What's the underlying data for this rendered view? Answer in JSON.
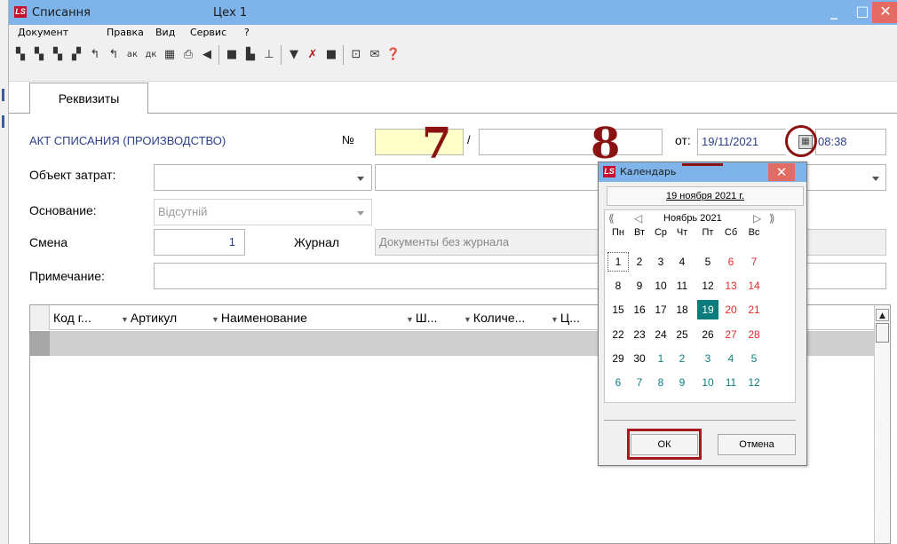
{
  "window": {
    "app_logo": "LS",
    "title": "Списання",
    "subtitle": "Цех 1",
    "min_label": "_",
    "max_label": "□",
    "close_label": "✕"
  },
  "menu": [
    "Документ",
    "Правка",
    "Вид",
    "Сервис",
    "?"
  ],
  "toolbar_icons": [
    "add-icon",
    "add-copy-icon",
    "add-group-icon",
    "edit-icon",
    "refresh-icon",
    "refresh-all-icon",
    "sort-asc-icon",
    "sort-desc-icon",
    "calc-icon",
    "print-icon",
    "previous-icon",
    "save-icon",
    "copy-icon",
    "tree-icon",
    "filter-icon",
    "clear-filter-icon",
    "table-icon",
    "preview-icon",
    "mail-icon",
    "help-icon"
  ],
  "tab": {
    "label": "Реквизиты"
  },
  "form": {
    "doc_type": "АКТ СПИСАНИЯ (ПРОИЗВОДСТВО)",
    "number_label": "№",
    "number_sep": "/",
    "date_label": "от:",
    "date_value": "19/11/2021",
    "time_value": "08:38",
    "cost_object_label": "Объект затрат:",
    "basis_label": "Основание:",
    "basis_value": "Відсутній",
    "shift_label": "Смена",
    "shift_value": "1",
    "journal_label": "Журнал",
    "journal_value": "Документы без журнала",
    "note_label": "Примечание:"
  },
  "grid": {
    "columns": [
      "Код г...",
      "Артикул",
      "Наименование",
      "Ш...",
      "Количе...",
      "Ц..."
    ]
  },
  "annotations": {
    "n7": "7",
    "n8": "8"
  },
  "calendar": {
    "title": "Календарь",
    "today_link": "19 ноября 2021 г.",
    "month_label": "Ноябрь 2021",
    "weekdays": [
      "Пн",
      "Вт",
      "Ср",
      "Чт",
      "Пт",
      "Сб",
      "Вс"
    ],
    "weeks": [
      [
        "1",
        "2",
        "3",
        "4",
        "5",
        "6",
        "7"
      ],
      [
        "8",
        "9",
        "10",
        "11",
        "12",
        "13",
        "14"
      ],
      [
        "15",
        "16",
        "17",
        "18",
        "19",
        "20",
        "21"
      ],
      [
        "22",
        "23",
        "24",
        "25",
        "26",
        "27",
        "28"
      ],
      [
        "29",
        "30",
        "1",
        "2",
        "3",
        "4",
        "5"
      ],
      [
        "6",
        "7",
        "8",
        "9",
        "10",
        "11",
        "12"
      ]
    ],
    "selected_day": "19",
    "ok_label": "ОК",
    "cancel_label": "Отмена"
  },
  "colors": {
    "title_bar": "#7eb4ea",
    "close_btn": "#e36b64",
    "selected_day": "#0b7c7c",
    "weekend": "#e02b2b",
    "other_month": "#0d7e7e",
    "number_field": "#ffffc8",
    "annotation": "#8b1212"
  }
}
